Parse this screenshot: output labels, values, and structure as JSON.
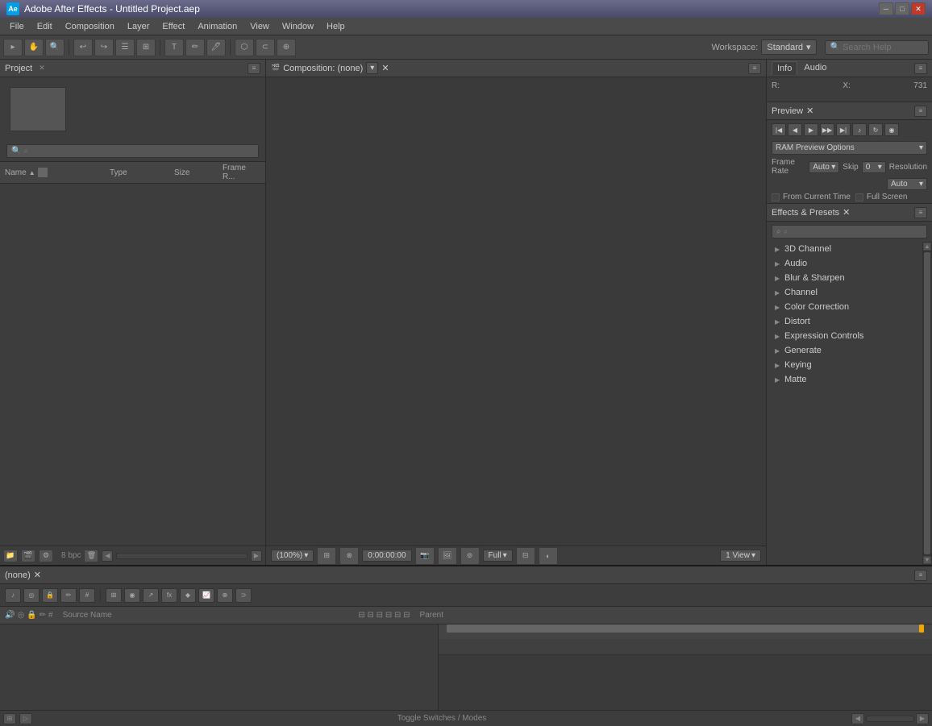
{
  "title_bar": {
    "app_name": "Adobe After Effects",
    "project_name": "Untitled Project.aep",
    "full_title": "Adobe After Effects - Untitled Project.aep",
    "ae_abbr": "Ae",
    "minimize_label": "─",
    "maximize_label": "□",
    "close_label": "✕"
  },
  "menu": {
    "items": [
      "File",
      "Edit",
      "Composition",
      "Layer",
      "Effect",
      "Animation",
      "View",
      "Window",
      "Help"
    ]
  },
  "toolbar": {
    "workspace_label": "Workspace:",
    "workspace_value": "Standard",
    "search_placeholder": "Search Help"
  },
  "project_panel": {
    "title": "Project",
    "columns": {
      "name": "Name",
      "type": "Type",
      "size": "Size",
      "frame_rate": "Frame R..."
    },
    "bpc_label": "8 bpc"
  },
  "composition_panel": {
    "title": "Composition: (none)",
    "zoom_label": "(100%)",
    "timecode": "0:00:00:00",
    "quality_label": "Full",
    "views_label": "1 View"
  },
  "info_panel": {
    "info_tab": "Info",
    "audio_tab": "Audio",
    "r_label": "R:",
    "x_label": "X:",
    "x_value": "731"
  },
  "preview_panel": {
    "title": "Preview",
    "ram_preview_label": "RAM Preview Options",
    "frame_rate_label": "Frame Rate",
    "frame_rate_value": "Auto",
    "skip_label": "Skip",
    "skip_value": "0",
    "resolution_label": "Resolution",
    "resolution_value": "Auto",
    "from_current_label": "From Current Time",
    "full_screen_label": "Full Screen",
    "buttons": {
      "first": "⏮",
      "prev": "◀",
      "play": "▶",
      "next": "▶▶",
      "last": "⏭",
      "audio": "♪",
      "loop": "↻",
      "ram": "◉"
    }
  },
  "effects_panel": {
    "title": "Effects & Presets",
    "search_placeholder": "🔍",
    "items": [
      "3D Channel",
      "Audio",
      "Blur & Sharpen",
      "Channel",
      "Color Correction",
      "Distort",
      "Expression Controls",
      "Generate",
      "Keying",
      "Matte"
    ]
  },
  "timeline_panel": {
    "title": "(none)",
    "source_name_col": "Source Name",
    "parent_col": "Parent",
    "toggle_switches_label": "Toggle Switches / Modes"
  },
  "colors": {
    "accent": "#f0a500",
    "panel_bg": "#3d3d3d",
    "header_bg": "#444444",
    "border": "#2a2a2a",
    "text_primary": "#cccccc",
    "text_secondary": "#aaaaaa"
  }
}
